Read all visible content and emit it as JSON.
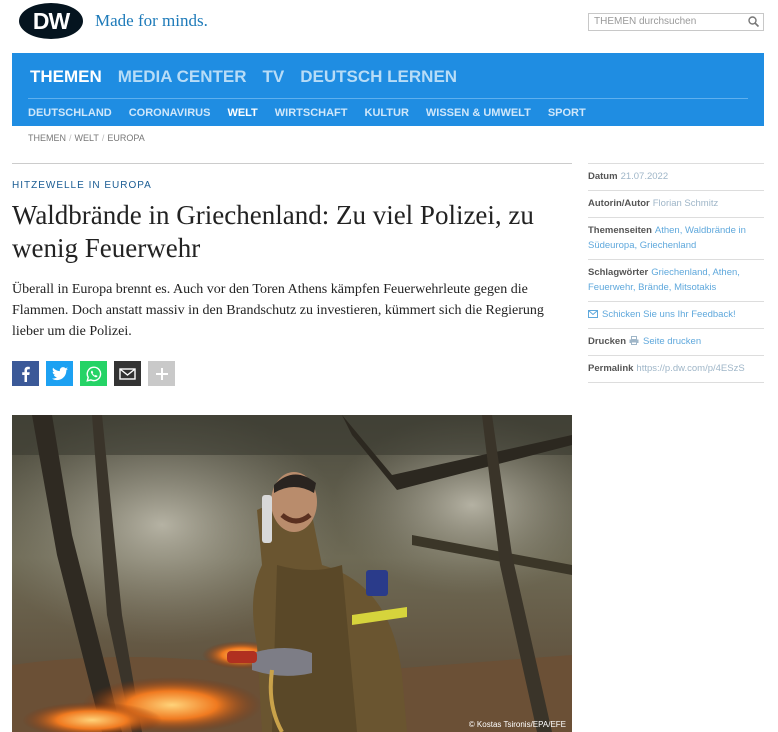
{
  "header": {
    "logo_text": "DW",
    "tagline": "Made for minds.",
    "search_placeholder": "THEMEN durchsuchen"
  },
  "nav": {
    "main": [
      "THEMEN",
      "MEDIA CENTER",
      "TV",
      "DEUTSCH LERNEN"
    ],
    "sub": [
      "DEUTSCHLAND",
      "CORONAVIRUS",
      "WELT",
      "WIRTSCHAFT",
      "KULTUR",
      "WISSEN & UMWELT",
      "SPORT"
    ]
  },
  "breadcrumb": [
    "THEMEN",
    "WELT",
    "EUROPA"
  ],
  "article": {
    "kicker": "HITZEWELLE IN EUROPA",
    "headline": "Waldbrände in Griechenland: Zu viel Polizei, zu wenig Feuerwehr",
    "teaser": "Überall in Europa brennt es. Auch vor den Toren Athens kämpfen Feuerwehrleute gegen die Flammen. Doch anstatt massiv in den Brandschutz zu investieren, kümmert sich die Regierung lieber um die Polizei.",
    "photo_credit": "© Kostas Tsironis/EPA/EFE"
  },
  "share_icons": [
    "facebook-icon",
    "twitter-icon",
    "whatsapp-icon",
    "mail-icon",
    "plus-icon"
  ],
  "sidebar": {
    "date_label": "Datum",
    "date_value": "21.07.2022",
    "author_label": "Autorin/Autor",
    "author_value": "Florian Schmitz",
    "topics_label": "Themenseiten",
    "topics_value": "Athen, Waldbrände in Südeuropa, Griechenland",
    "keywords_label": "Schlagwörter",
    "keywords_value": "Griechenland, Athen, Feuerwehr, Brände, Mitsotakis",
    "feedback": "Schicken Sie uns Ihr Feedback!",
    "print_label": "Drucken",
    "print_value": "Seite drucken",
    "permalink_label": "Permalink",
    "permalink_value": "https://p.dw.com/p/4ESzS"
  },
  "colors": {
    "brand_blue": "#1f8de2",
    "logo_dark": "#05141f",
    "kicker": "#1a5c93"
  }
}
